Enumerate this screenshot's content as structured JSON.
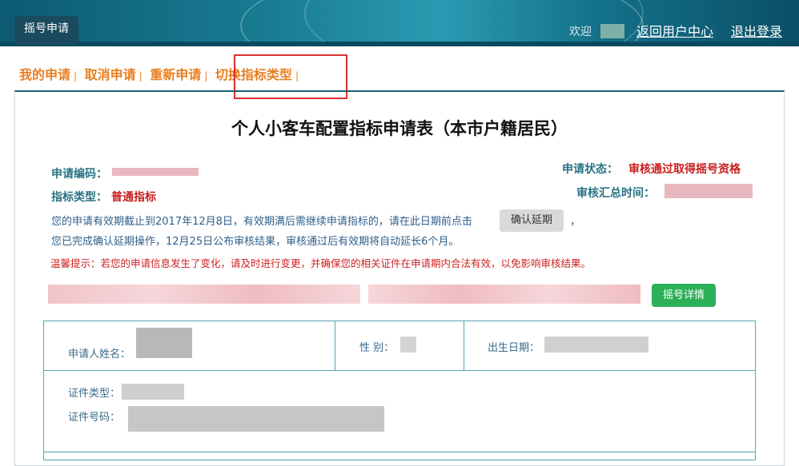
{
  "header": {
    "tab": "摇号申请",
    "welcome": "欢迎",
    "links": [
      "返回用户中心",
      "退出登录"
    ]
  },
  "nav": {
    "items": [
      "我的申请",
      "取消申请",
      "重新申请",
      "切换指标类型"
    ]
  },
  "form": {
    "title": "个人小客车配置指标申请表（本市户籍居民）",
    "app_code_label": "申请编码：",
    "index_type_label": "指标类型：",
    "index_type_value": "普通指标",
    "status_label": "申请状态：",
    "status_value": "审核通过取得摇号资格",
    "audit_time_label": "审核汇总时间：",
    "notice_line1": "您的申请有效期截止到2017年12月8日，有效期满后需继续申请指标的，请在此日期前点击",
    "notice_line1_suffix": "，",
    "confirm_button": "确认延期",
    "notice_line2": "您已完成确认延期操作，12月25日公布审核结果，审核通过后有效期将自动延长6个月。",
    "warning": "温馨提示：若您的申请信息发生了变化，请及时进行变更，并确保您的相关证件在申请期内合法有效，以免影响审核结果。",
    "lottery_details_button": "摇号详情"
  },
  "table": {
    "name_label": "申请人姓名：",
    "gender_label": "性  别：",
    "birth_label": "出生日期：",
    "id_type_label": "证件类型：",
    "id_number_label": "证件号码："
  },
  "colors": {
    "accent_orange": "#e87e1f",
    "status_red": "#c81e1e",
    "teal_label": "#2a7384",
    "green_button": "#2cb057",
    "highlight_red": "#d93030"
  }
}
